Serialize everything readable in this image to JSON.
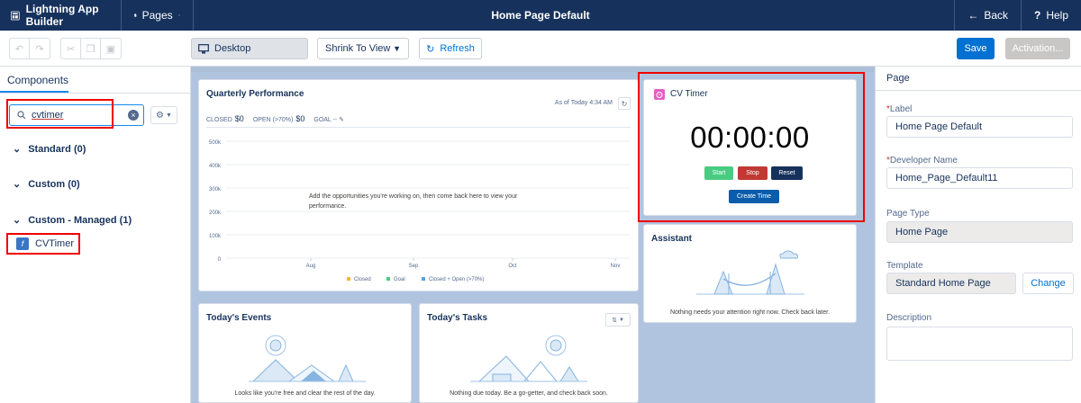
{
  "topbar": {
    "app_title": "Lightning App Builder",
    "pages_label": "Pages",
    "page_title": "Home Page Default",
    "back_label": "Back",
    "help_label": "Help"
  },
  "toolbar": {
    "device": "Desktop",
    "zoom": "Shrink To View",
    "refresh": "Refresh",
    "save": "Save",
    "activation": "Activation..."
  },
  "left_panel": {
    "tab": "Components",
    "search_value": "cvtimer",
    "sections": {
      "standard": "Standard (0)",
      "custom": "Custom (0)",
      "custom_managed": "Custom - Managed (1)"
    },
    "component_item": "CVTimer"
  },
  "quarterly": {
    "title": "Quarterly Performance",
    "as_of": "As of Today 4:34 AM",
    "closed_label": "CLOSED",
    "closed_value": "$0",
    "open_label": "OPEN (>70%)",
    "open_value": "$0",
    "goal_label": "GOAL",
    "goal_value": "--",
    "empty_line1": "Add the opportunities you're working on, then come back here to view your",
    "empty_line2": "performance.",
    "legend": [
      "Closed",
      "Goal",
      "Closed + Open (>70%)"
    ]
  },
  "chart_data": {
    "type": "line",
    "categories": [
      "Aug",
      "Sep",
      "Oct",
      "Nov"
    ],
    "ytick_labels": [
      "0",
      "100k",
      "200k",
      "300k",
      "400k",
      "500k"
    ],
    "ylim": [
      0,
      500000
    ],
    "series": []
  },
  "timer": {
    "title": "CV Timer",
    "display": "00:00:00",
    "start": "Start",
    "stop": "Stop",
    "reset": "Reset",
    "create": "Create Time",
    "colors": {
      "start": "#4bca81",
      "stop": "#c23934",
      "reset": "#16325c",
      "create": "#0b5cab"
    }
  },
  "assistant": {
    "title": "Assistant",
    "message": "Nothing needs your attention right now. Check back later."
  },
  "events": {
    "title": "Today's Events",
    "message": "Looks like you're free and clear the rest of the day."
  },
  "tasks": {
    "title": "Today's Tasks",
    "message": "Nothing due today. Be a go-getter, and check back soon."
  },
  "right_panel": {
    "title": "Page",
    "label_label": "Label",
    "label_value": "Home Page Default",
    "dev_name_label": "Developer Name",
    "dev_name_value": "Home_Page_Default11",
    "page_type_label": "Page Type",
    "page_type_value": "Home Page",
    "template_label": "Template",
    "template_value": "Standard Home Page",
    "change": "Change",
    "description_label": "Description",
    "description_value": ""
  }
}
